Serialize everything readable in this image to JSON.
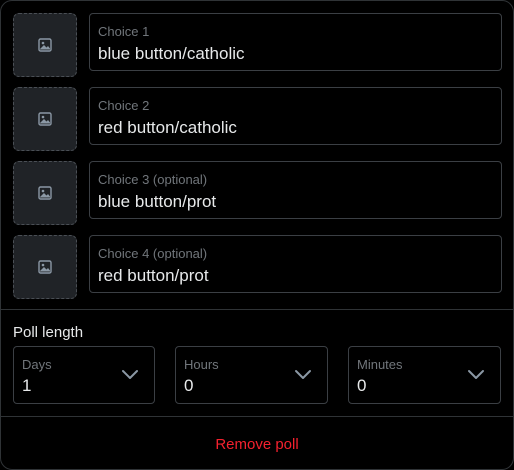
{
  "poll": {
    "choices": [
      {
        "label": "Choice 1",
        "value": "blue button/catholic",
        "media_icon": "image-icon"
      },
      {
        "label": "Choice 2",
        "value": "red button/catholic",
        "media_icon": "image-icon"
      },
      {
        "label": "Choice 3 (optional)",
        "value": "blue button/prot",
        "media_icon": "image-icon"
      },
      {
        "label": "Choice 4 (optional)",
        "value": "red button/prot",
        "media_icon": "image-icon"
      }
    ],
    "length": {
      "title": "Poll length",
      "days": {
        "label": "Days",
        "value": "1"
      },
      "hours": {
        "label": "Hours",
        "value": "0"
      },
      "minutes": {
        "label": "Minutes",
        "value": "0"
      }
    },
    "remove_label": "Remove poll"
  },
  "colors": {
    "background": "#000000",
    "border": "#2f3336",
    "text_primary": "#e7e9ea",
    "text_secondary": "#71767b",
    "danger": "#f4212e",
    "media_fill": "#202327"
  },
  "icons": {
    "media": "image-icon",
    "dropdown": "chevron-down-icon"
  }
}
